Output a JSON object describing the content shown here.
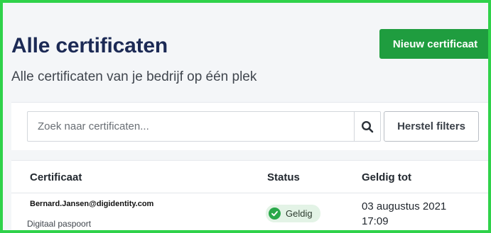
{
  "header": {
    "title": "Alle certificaten",
    "subtitle": "Alle certificaten van je bedrijf op één plek",
    "new_button_label": "Nieuw certificaat"
  },
  "search": {
    "placeholder": "Zoek naar certificaten...",
    "value": "",
    "search_icon": "search-icon",
    "reset_label": "Herstel filters"
  },
  "table": {
    "columns": [
      "Certificaat",
      "Status",
      "Geldig tot"
    ],
    "rows": [
      {
        "email": "Bernard.Jansen@digidentity.com",
        "type": "Digitaal paspoort",
        "status": "Geldig",
        "status_icon": "check-circle-icon",
        "valid_until_date": "03 augustus 2021",
        "valid_until_time": "17:09"
      }
    ]
  },
  "colors": {
    "frame_border": "#2fd24a",
    "primary_button": "#1f9d3f",
    "title": "#1c2a55",
    "status_badge_bg": "#e3f3e6",
    "status_icon": "#2aa84a"
  }
}
